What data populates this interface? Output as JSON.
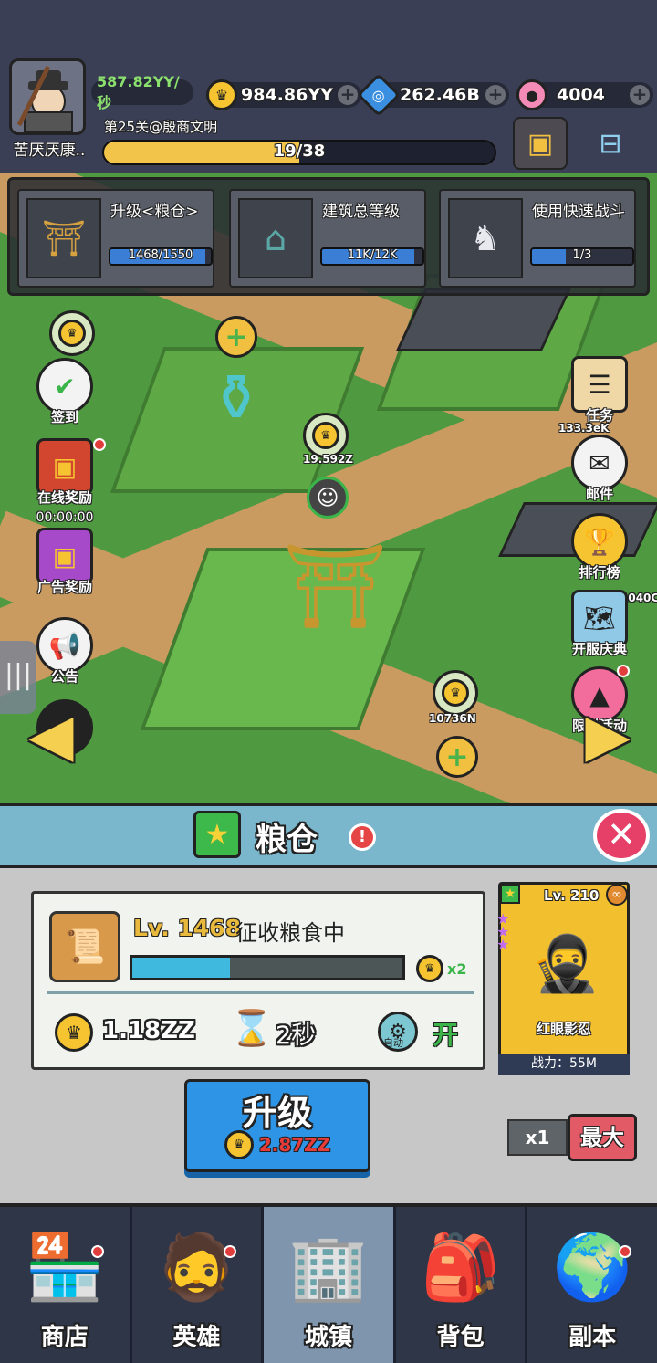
{
  "player": {
    "name": "苦厌厌康..",
    "stage": "第25关@殷商文明",
    "stage_progress": "19/38",
    "stage_fraction": 0.5
  },
  "resources": {
    "rate": "587.82YY/秒",
    "gold": "984.86YY",
    "gems": "262.46B",
    "candy": "4004"
  },
  "quests": [
    {
      "title": "升级<粮仓>",
      "progress": "1468/1550",
      "fraction": 0.947
    },
    {
      "title": "建筑总等级",
      "progress": "11K/12K",
      "fraction": 0.917
    },
    {
      "title": "使用快速战斗",
      "progress": "1/3",
      "fraction": 0.333
    }
  ],
  "left_menu": {
    "sign_in": "签到",
    "online_reward": "在线奖励",
    "online_timer": "00:00:00",
    "ad_reward": "广告奖励",
    "notice": "公告"
  },
  "right_menu": {
    "tasks": "任务",
    "mail": "邮件",
    "ranking": "排行榜",
    "anniversary": "开服庆典",
    "limited_event": "限时活动"
  },
  "map_values": {
    "v1": "19.592Z",
    "v2": "10736N",
    "v3": "1040C",
    "v4": "133.3eK"
  },
  "panel": {
    "title": "粮仓",
    "level": "Lv. 1468",
    "status": "征收粮食中",
    "production_fraction": 0.36,
    "multiplier": "x2",
    "cost": "1.18ZZ",
    "time": "2秒",
    "auto_label": "自动",
    "auto_state": "开",
    "upgrade_label": "升级",
    "upgrade_cost": "2.87ZZ",
    "x1_label": "x1",
    "max_label": "最大"
  },
  "hero": {
    "level": "Lv. 210",
    "name": "红眼影忍",
    "power": "战力：55M"
  },
  "nav": [
    {
      "label": "商店",
      "icon": "shop-icon"
    },
    {
      "label": "英雄",
      "icon": "hero-icon"
    },
    {
      "label": "城镇",
      "icon": "town-icon"
    },
    {
      "label": "背包",
      "icon": "backpack-icon"
    },
    {
      "label": "副本",
      "icon": "globe-icon"
    }
  ]
}
